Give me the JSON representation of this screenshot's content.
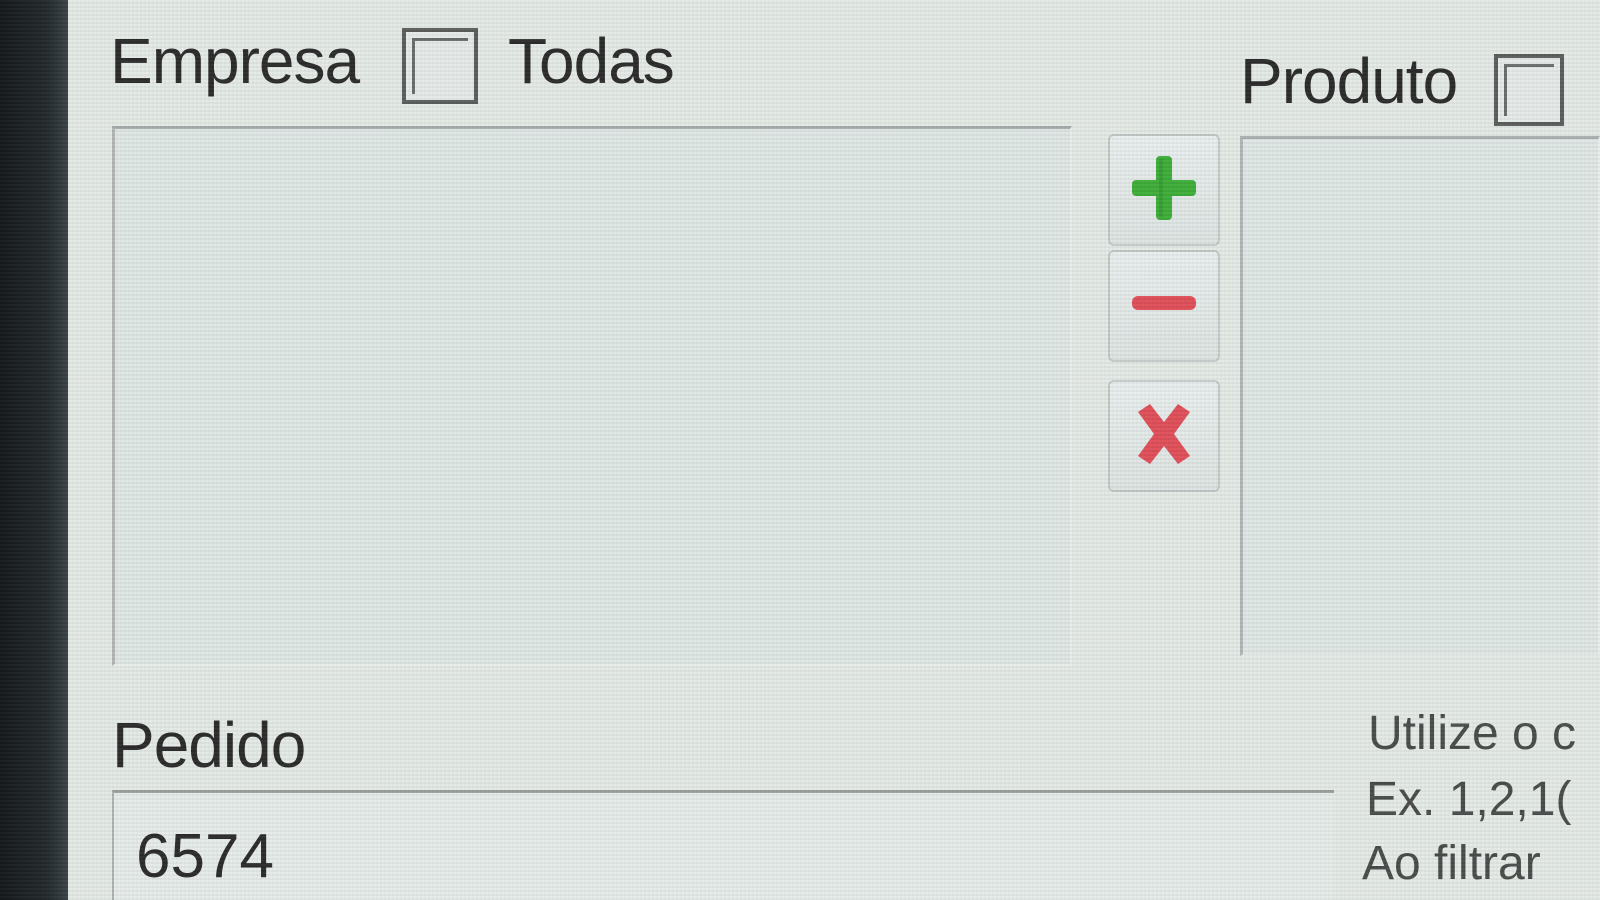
{
  "empresa": {
    "label": "Empresa",
    "todas_label": "Todas"
  },
  "produto": {
    "label": "Produto"
  },
  "list_buttons": {
    "add_icon": "plus-icon",
    "remove_icon": "minus-icon",
    "clear_icon": "x-icon",
    "colors": {
      "add": "#3fae3a",
      "remove": "#e0505a",
      "clear": "#e0505a"
    }
  },
  "pedido": {
    "label": "Pedido",
    "value": "6574"
  },
  "hints": {
    "line1": "Utilize o c",
    "line2": "Ex. 1,2,1(",
    "line3": "Ao filtrar"
  }
}
